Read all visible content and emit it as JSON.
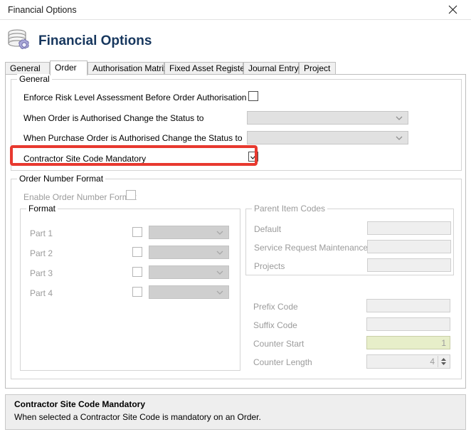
{
  "window": {
    "title": "Financial Options",
    "close_label": "✕"
  },
  "header": {
    "heading": "Financial Options",
    "icon": "database-gear-icon"
  },
  "tabs": [
    {
      "label": "General",
      "active": false
    },
    {
      "label": "Order",
      "active": true
    },
    {
      "label": "Authorisation Matrix",
      "active": false
    },
    {
      "label": "Fixed Asset Register",
      "active": false
    },
    {
      "label": "Journal Entry",
      "active": false
    },
    {
      "label": "Project",
      "active": false
    }
  ],
  "general_group": {
    "legend": "General",
    "rows": [
      {
        "label": "Enforce Risk Level Assessment Before Order Authorisation",
        "control": "checkbox",
        "checked": false
      },
      {
        "label": "When Order is Authorised Change the Status to",
        "control": "combobox",
        "value": ""
      },
      {
        "label": "When Purchase Order is Authorised Change the Status to",
        "control": "combobox",
        "value": ""
      },
      {
        "label": "Contractor Site Code Mandatory",
        "control": "checkbox",
        "checked": true,
        "highlighted": true
      }
    ]
  },
  "order_number_format_group": {
    "legend": "Order Number Format",
    "enable_label": "Enable Order Number Format",
    "enable_checked": false,
    "format_group": {
      "legend": "Format",
      "parts": [
        {
          "label": "Part 1",
          "checked": false,
          "value": ""
        },
        {
          "label": "Part 2",
          "checked": false,
          "value": ""
        },
        {
          "label": "Part 3",
          "checked": false,
          "value": ""
        },
        {
          "label": "Part 4",
          "checked": false,
          "value": ""
        }
      ]
    },
    "parent_item_codes": {
      "legend": "Parent Item Codes",
      "fields": [
        {
          "label": "Default",
          "value": ""
        },
        {
          "label": "Service Request Maintenance",
          "value": ""
        },
        {
          "label": "Projects",
          "value": ""
        }
      ]
    },
    "counter_fields": [
      {
        "label": "Prefix Code",
        "value": "",
        "style": "plain"
      },
      {
        "label": "Suffix Code",
        "value": "",
        "style": "plain"
      },
      {
        "label": "Counter Start",
        "value": "1",
        "style": "green"
      },
      {
        "label": "Counter Length",
        "value": "4",
        "style": "spinner"
      }
    ]
  },
  "help": {
    "title": "Contractor Site Code Mandatory",
    "body": "When selected a Contractor Site Code is mandatory on an Order."
  },
  "colors": {
    "accent_highlight": "#e8392f",
    "heading": "#17375e",
    "disabled_text": "#9b9b9b",
    "counter_start_bg": "#e7eec9"
  }
}
